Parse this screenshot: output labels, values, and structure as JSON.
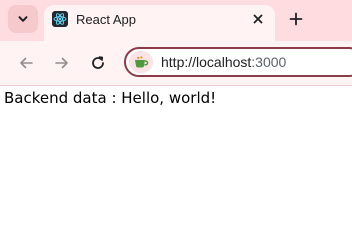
{
  "tab": {
    "title": "React App",
    "favicon": "react-icon"
  },
  "tabstrip": {
    "tab_list_icon": "chevron-down-icon",
    "new_tab_icon": "plus-icon"
  },
  "toolbar": {
    "back_icon": "arrow-left-icon",
    "forward_icon": "arrow-right-icon",
    "reload_icon": "reload-icon",
    "site_info_icon": "site-info-icon"
  },
  "omnibox": {
    "url_host": "http://localhost",
    "url_port": ":3000"
  },
  "page": {
    "text": "Backend data : Hello, world!"
  },
  "colors": {
    "frame": "#ffdcdf",
    "toolbar": "#fff3f4",
    "omnibox_border": "#8c3c49",
    "page_background": "#ffffff"
  }
}
